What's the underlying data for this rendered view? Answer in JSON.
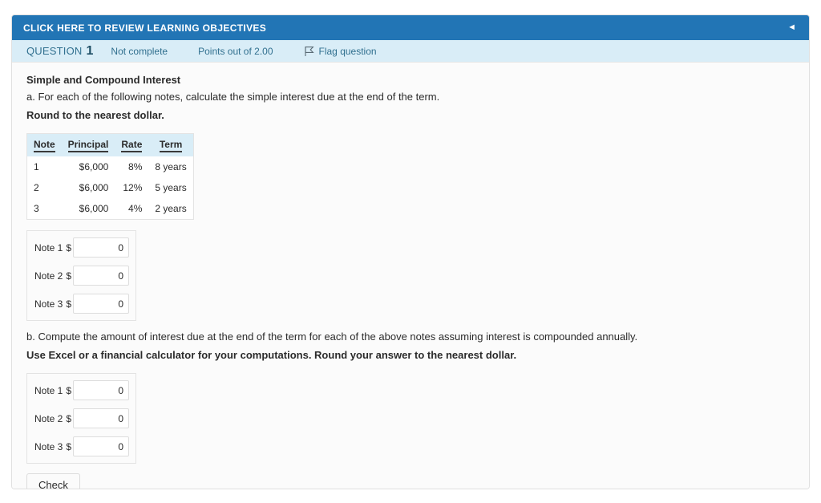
{
  "objectives_bar": {
    "label": "CLICK HERE TO REVIEW LEARNING OBJECTIVES",
    "collapse_icon": "caret-left-icon",
    "collapse_glyph": "◄",
    "background_color": "#2275b5"
  },
  "info_bar": {
    "question_word": "QUESTION",
    "question_number": "1",
    "status": "Not complete",
    "points": "Points out of 2.00",
    "flag_label": "Flag question",
    "flag_icon": "flag-icon",
    "background_color": "#d9edf7",
    "text_color": "#31708f"
  },
  "question": {
    "title": "Simple and Compound Interest",
    "part_a": "a. For each of the following notes, calculate the simple interest due at the end of the term.",
    "part_a_instruction": "Round to the nearest dollar.",
    "part_b": "b. Compute the amount of interest due at the end of the term for each of the above notes assuming interest is compounded annually.",
    "part_b_instruction": "Use Excel or a financial calculator for your computations. Round your answer to the nearest dollar."
  },
  "notes_table": {
    "columns": [
      "Note",
      "Principal",
      "Rate",
      "Term"
    ],
    "rows": [
      {
        "note": "1",
        "principal": "$6,000",
        "rate": "8%",
        "term": "8 years"
      },
      {
        "note": "2",
        "principal": "$6,000",
        "rate": "12%",
        "term": "5 years"
      },
      {
        "note": "3",
        "principal": "$6,000",
        "rate": "4%",
        "term": "2 years"
      }
    ]
  },
  "answers_part_a": {
    "currency_symbol": "$",
    "rows": [
      {
        "label": "Note 1",
        "value": "0"
      },
      {
        "label": "Note 2",
        "value": "0"
      },
      {
        "label": "Note 3",
        "value": "0"
      }
    ]
  },
  "answers_part_b": {
    "currency_symbol": "$",
    "rows": [
      {
        "label": "Note 1",
        "value": "0"
      },
      {
        "label": "Note 2",
        "value": "0"
      },
      {
        "label": "Note 3",
        "value": "0"
      }
    ]
  },
  "actions": {
    "check_label": "Check"
  }
}
